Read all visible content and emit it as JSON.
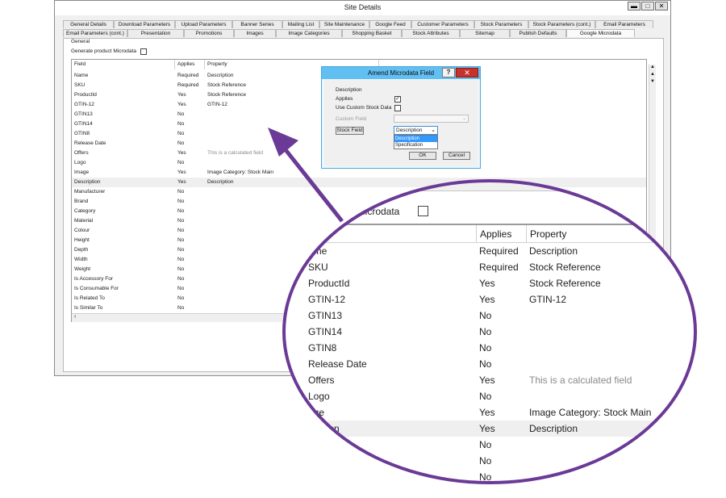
{
  "window": {
    "title": "Site Details",
    "min_label": "▬",
    "max_label": "□",
    "close_label": "✕"
  },
  "tabs_row1": [
    "General Details",
    "Download Parameters",
    "Upload Parameters",
    "Banner Series",
    "Mailing List",
    "Site Maintenance",
    "Google Feed",
    "Customer Parameters",
    "Stock Parameters",
    "Stock Parameters (cont.)",
    "Email Parameters"
  ],
  "tabs_row2": [
    "Email Parameters (cont.)",
    "Presentation",
    "Promotions",
    "Images",
    "Image Categories",
    "Shopping Basket",
    "Stock Attributes",
    "Sitemap",
    "Publish Defaults",
    "Google Microdata"
  ],
  "panel": {
    "section_label": "General",
    "generate_label": "Generate product Microdata"
  },
  "grid": {
    "headers": [
      "Field",
      "Applies",
      "Property"
    ],
    "rows": [
      {
        "field": "Name",
        "applies": "Required",
        "property": "Description"
      },
      {
        "field": "SKU",
        "applies": "Required",
        "property": "Stock Reference"
      },
      {
        "field": "ProductId",
        "applies": "Yes",
        "property": "Stock Reference"
      },
      {
        "field": "GTIN-12",
        "applies": "Yes",
        "property": "GTIN-12"
      },
      {
        "field": "GTIN13",
        "applies": "No",
        "property": ""
      },
      {
        "field": "GTIN14",
        "applies": "No",
        "property": ""
      },
      {
        "field": "GTIN8",
        "applies": "No",
        "property": ""
      },
      {
        "field": "Release Date",
        "applies": "No",
        "property": ""
      },
      {
        "field": "Offers",
        "applies": "Yes",
        "property": "This is a calculated field"
      },
      {
        "field": "Logo",
        "applies": "No",
        "property": ""
      },
      {
        "field": "Image",
        "applies": "Yes",
        "property": "Image Category: Stock Main"
      },
      {
        "field": "Description",
        "applies": "Yes",
        "property": "Description"
      },
      {
        "field": "Manufacturer",
        "applies": "No",
        "property": ""
      },
      {
        "field": "Brand",
        "applies": "No",
        "property": ""
      },
      {
        "field": "Category",
        "applies": "No",
        "property": ""
      },
      {
        "field": "Material",
        "applies": "No",
        "property": ""
      },
      {
        "field": "Colour",
        "applies": "No",
        "property": ""
      },
      {
        "field": "Height",
        "applies": "No",
        "property": ""
      },
      {
        "field": "Depth",
        "applies": "No",
        "property": ""
      },
      {
        "field": "Width",
        "applies": "No",
        "property": ""
      },
      {
        "field": "Weight",
        "applies": "No",
        "property": ""
      },
      {
        "field": "Is Accessory For",
        "applies": "No",
        "property": ""
      },
      {
        "field": "Is Consumable For",
        "applies": "No",
        "property": ""
      },
      {
        "field": "Is Related To",
        "applies": "No",
        "property": ""
      },
      {
        "field": "Is Similar To",
        "applies": "No",
        "property": ""
      }
    ]
  },
  "dialog": {
    "title": "Amend Microdata Field",
    "help_label": "?",
    "close_label": "✕",
    "field_name": "Description",
    "applies_label": "Applies",
    "custom_stock_label": "Use Custom Stock Data",
    "custom_field_label": "Custom Field",
    "stock_field_label": "Stock Field",
    "stock_field_value": "Description",
    "options": [
      "Description",
      "Specification"
    ],
    "ok_label": "OK",
    "cancel_label": "Cancel"
  },
  "zoom": {
    "checkbox_label": "ct Microdata",
    "headers": [
      "Applies",
      "Property"
    ],
    "rows": [
      {
        "field": "ame",
        "applies": "Required",
        "property": "Description"
      },
      {
        "field": "SKU",
        "applies": "Required",
        "property": "Stock Reference"
      },
      {
        "field": "ProductId",
        "applies": "Yes",
        "property": "Stock Reference"
      },
      {
        "field": "GTIN-12",
        "applies": "Yes",
        "property": "GTIN-12"
      },
      {
        "field": "GTIN13",
        "applies": "No",
        "property": ""
      },
      {
        "field": "GTIN14",
        "applies": "No",
        "property": ""
      },
      {
        "field": "GTIN8",
        "applies": "No",
        "property": ""
      },
      {
        "field": "Release Date",
        "applies": "No",
        "property": ""
      },
      {
        "field": "Offers",
        "applies": "Yes",
        "property": "This is a calculated field"
      },
      {
        "field": "Logo",
        "applies": "No",
        "property": ""
      },
      {
        "field": "age",
        "applies": "Yes",
        "property": "Image Category: Stock Main"
      },
      {
        "field": "cription",
        "applies": "Yes",
        "property": "Description"
      },
      {
        "field": "er",
        "applies": "No",
        "property": ""
      },
      {
        "field": "",
        "applies": "No",
        "property": ""
      },
      {
        "field": "",
        "applies": "No",
        "property": ""
      }
    ]
  },
  "colors": {
    "accent_purple": "#6a3a96",
    "dialog_title": "#62bff2",
    "dialog_close": "#c7322b"
  }
}
